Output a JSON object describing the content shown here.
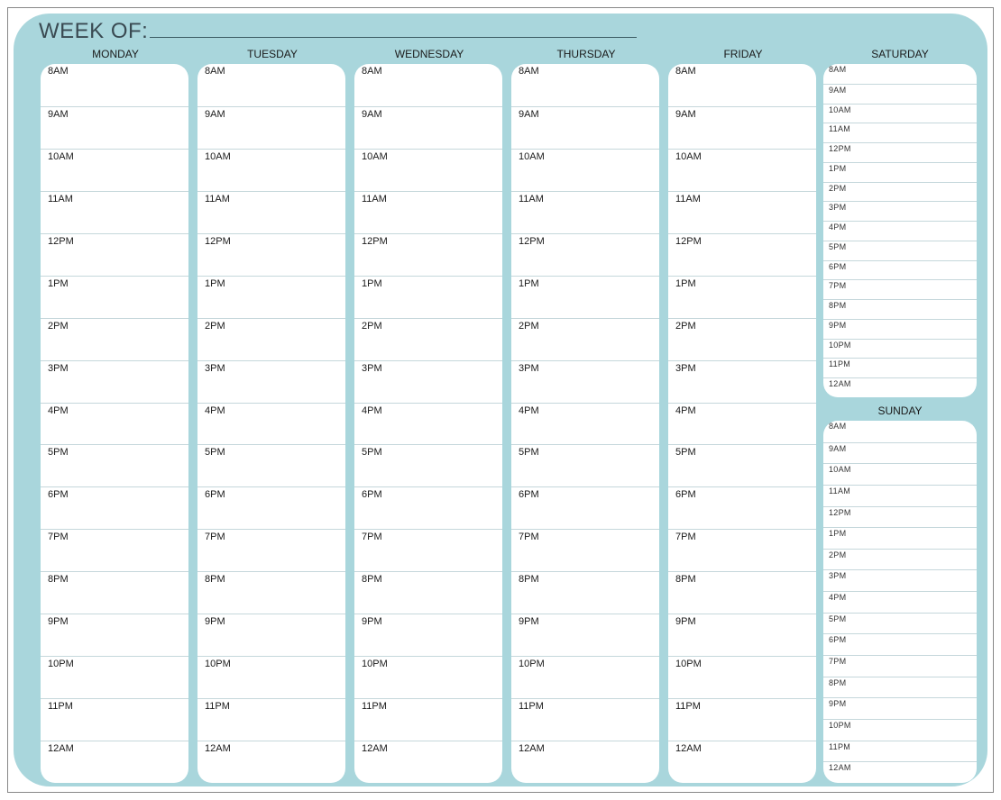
{
  "header": {
    "label": "WEEK OF:"
  },
  "days": {
    "mon": "MONDAY",
    "tue": "TUESDAY",
    "wed": "WEDNESDAY",
    "thu": "THURSDAY",
    "fri": "FRIDAY",
    "sat": "SATURDAY",
    "sun": "SUNDAY"
  },
  "weekday_hours": [
    "8AM",
    "9AM",
    "10AM",
    "11AM",
    "12PM",
    "1PM",
    "2PM",
    "3PM",
    "4PM",
    "5PM",
    "6PM",
    "7PM",
    "8PM",
    "9PM",
    "10PM",
    "11PM",
    "12AM"
  ],
  "weekend_hours": [
    "8AM",
    "9AM",
    "10AM",
    "11AM",
    "12PM",
    "1PM",
    "2PM",
    "3PM",
    "4PM",
    "5PM",
    "6PM",
    "7PM",
    "8PM",
    "9PM",
    "10PM",
    "11PM",
    "12AM"
  ]
}
